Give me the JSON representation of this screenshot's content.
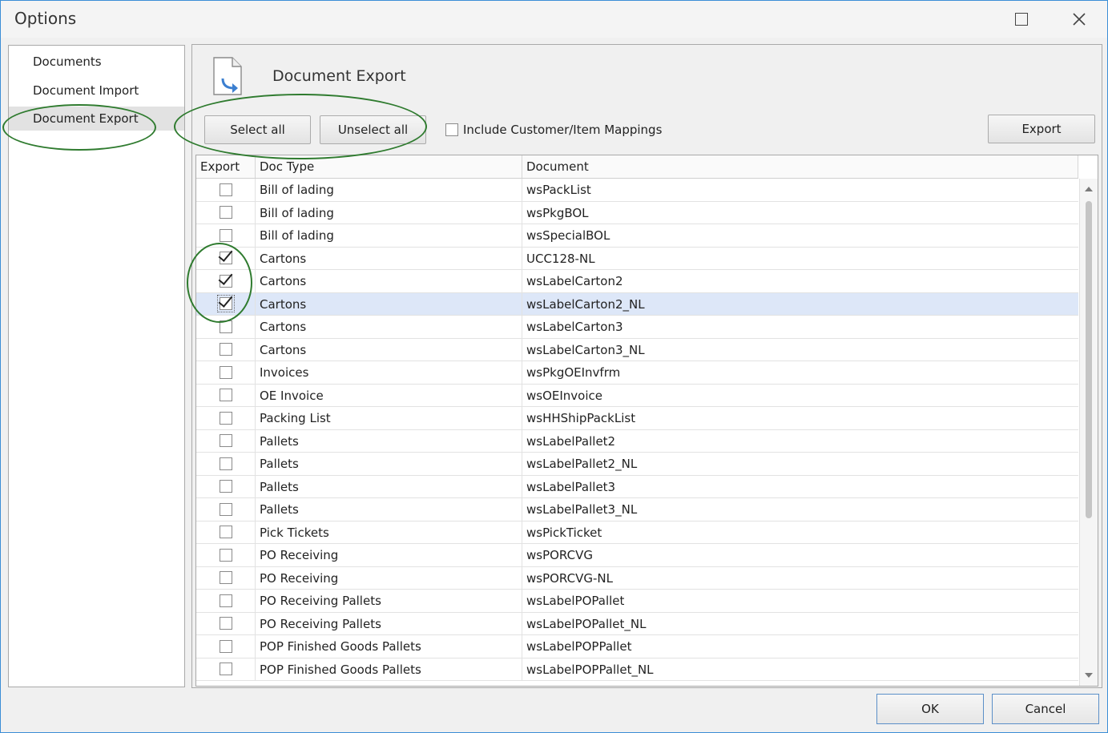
{
  "window": {
    "title": "Options"
  },
  "nav": {
    "items": [
      "Documents",
      "Document Import",
      "Document Export"
    ],
    "selected": "Document Export"
  },
  "panel": {
    "title": "Document Export",
    "select_all": "Select all",
    "unselect_all": "Unselect all",
    "include_mappings": "Include Customer/Item Mappings",
    "include_mappings_checked": false,
    "export_button": "Export"
  },
  "grid": {
    "columns": [
      "Export",
      "Doc Type",
      "Document"
    ],
    "rows": [
      {
        "export": false,
        "doc_type": "Bill of lading",
        "document": "wsPackList"
      },
      {
        "export": false,
        "doc_type": "Bill of lading",
        "document": "wsPkgBOL"
      },
      {
        "export": false,
        "doc_type": "Bill of lading",
        "document": "wsSpecialBOL"
      },
      {
        "export": true,
        "doc_type": "Cartons",
        "document": "UCC128-NL"
      },
      {
        "export": true,
        "doc_type": "Cartons",
        "document": "wsLabelCarton2"
      },
      {
        "export": true,
        "doc_type": "Cartons",
        "document": "wsLabelCarton2_NL",
        "selected": true
      },
      {
        "export": false,
        "doc_type": "Cartons",
        "document": "wsLabelCarton3"
      },
      {
        "export": false,
        "doc_type": "Cartons",
        "document": "wsLabelCarton3_NL"
      },
      {
        "export": false,
        "doc_type": "Invoices",
        "document": "wsPkgOEInvfrm"
      },
      {
        "export": false,
        "doc_type": "OE Invoice",
        "document": "wsOEInvoice"
      },
      {
        "export": false,
        "doc_type": "Packing List",
        "document": "wsHHShipPackList"
      },
      {
        "export": false,
        "doc_type": "Pallets",
        "document": "wsLabelPallet2"
      },
      {
        "export": false,
        "doc_type": "Pallets",
        "document": "wsLabelPallet2_NL"
      },
      {
        "export": false,
        "doc_type": "Pallets",
        "document": "wsLabelPallet3"
      },
      {
        "export": false,
        "doc_type": "Pallets",
        "document": "wsLabelPallet3_NL"
      },
      {
        "export": false,
        "doc_type": "Pick Tickets",
        "document": "wsPickTicket"
      },
      {
        "export": false,
        "doc_type": "PO Receiving",
        "document": "wsPORCVG"
      },
      {
        "export": false,
        "doc_type": "PO Receiving",
        "document": "wsPORCVG-NL"
      },
      {
        "export": false,
        "doc_type": "PO Receiving Pallets",
        "document": "wsLabelPOPallet"
      },
      {
        "export": false,
        "doc_type": "PO Receiving Pallets",
        "document": "wsLabelPOPallet_NL"
      },
      {
        "export": false,
        "doc_type": "POP Finished Goods Pallets",
        "document": "wsLabelPOPPallet"
      },
      {
        "export": false,
        "doc_type": "POP Finished Goods Pallets",
        "document": "wsLabelPOPPallet_NL"
      }
    ]
  },
  "footer": {
    "ok": "OK",
    "cancel": "Cancel"
  },
  "colors": {
    "annotation": "#2f7b2f",
    "selected_row": "#dde7f8",
    "window_border": "#3b8ed6"
  }
}
